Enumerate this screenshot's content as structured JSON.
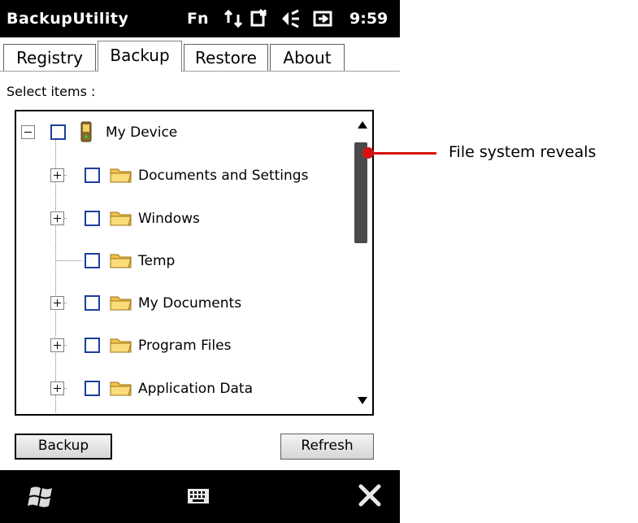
{
  "status_bar": {
    "app_title": "BackupUtility",
    "fn_label": "Fn",
    "time": "9:59"
  },
  "tabs": [
    {
      "label": "Registry",
      "active": false
    },
    {
      "label": "Backup",
      "active": true
    },
    {
      "label": "Restore",
      "active": false
    },
    {
      "label": "About",
      "active": false
    }
  ],
  "select_label": "Select items :",
  "tree": {
    "root": {
      "label": "My Device",
      "expanded": true,
      "checked": false
    },
    "children": [
      {
        "label": "Documents and Settings",
        "expandable": true,
        "checked": false
      },
      {
        "label": "Windows",
        "expandable": true,
        "checked": false
      },
      {
        "label": "Temp",
        "expandable": false,
        "checked": false
      },
      {
        "label": "My Documents",
        "expandable": true,
        "checked": false
      },
      {
        "label": "Program Files",
        "expandable": true,
        "checked": false
      },
      {
        "label": "Application Data",
        "expandable": true,
        "checked": false
      }
    ]
  },
  "buttons": {
    "backup": "Backup",
    "refresh": "Refresh"
  },
  "callout": {
    "text": "File system reveals",
    "color": "#d81010"
  },
  "colors": {
    "checkbox_border": "#1c3f9e",
    "folder": "#f2c24a"
  },
  "icons": {
    "start": "windows-start-icon",
    "keyboard": "keyboard-icon",
    "close": "close-icon"
  }
}
